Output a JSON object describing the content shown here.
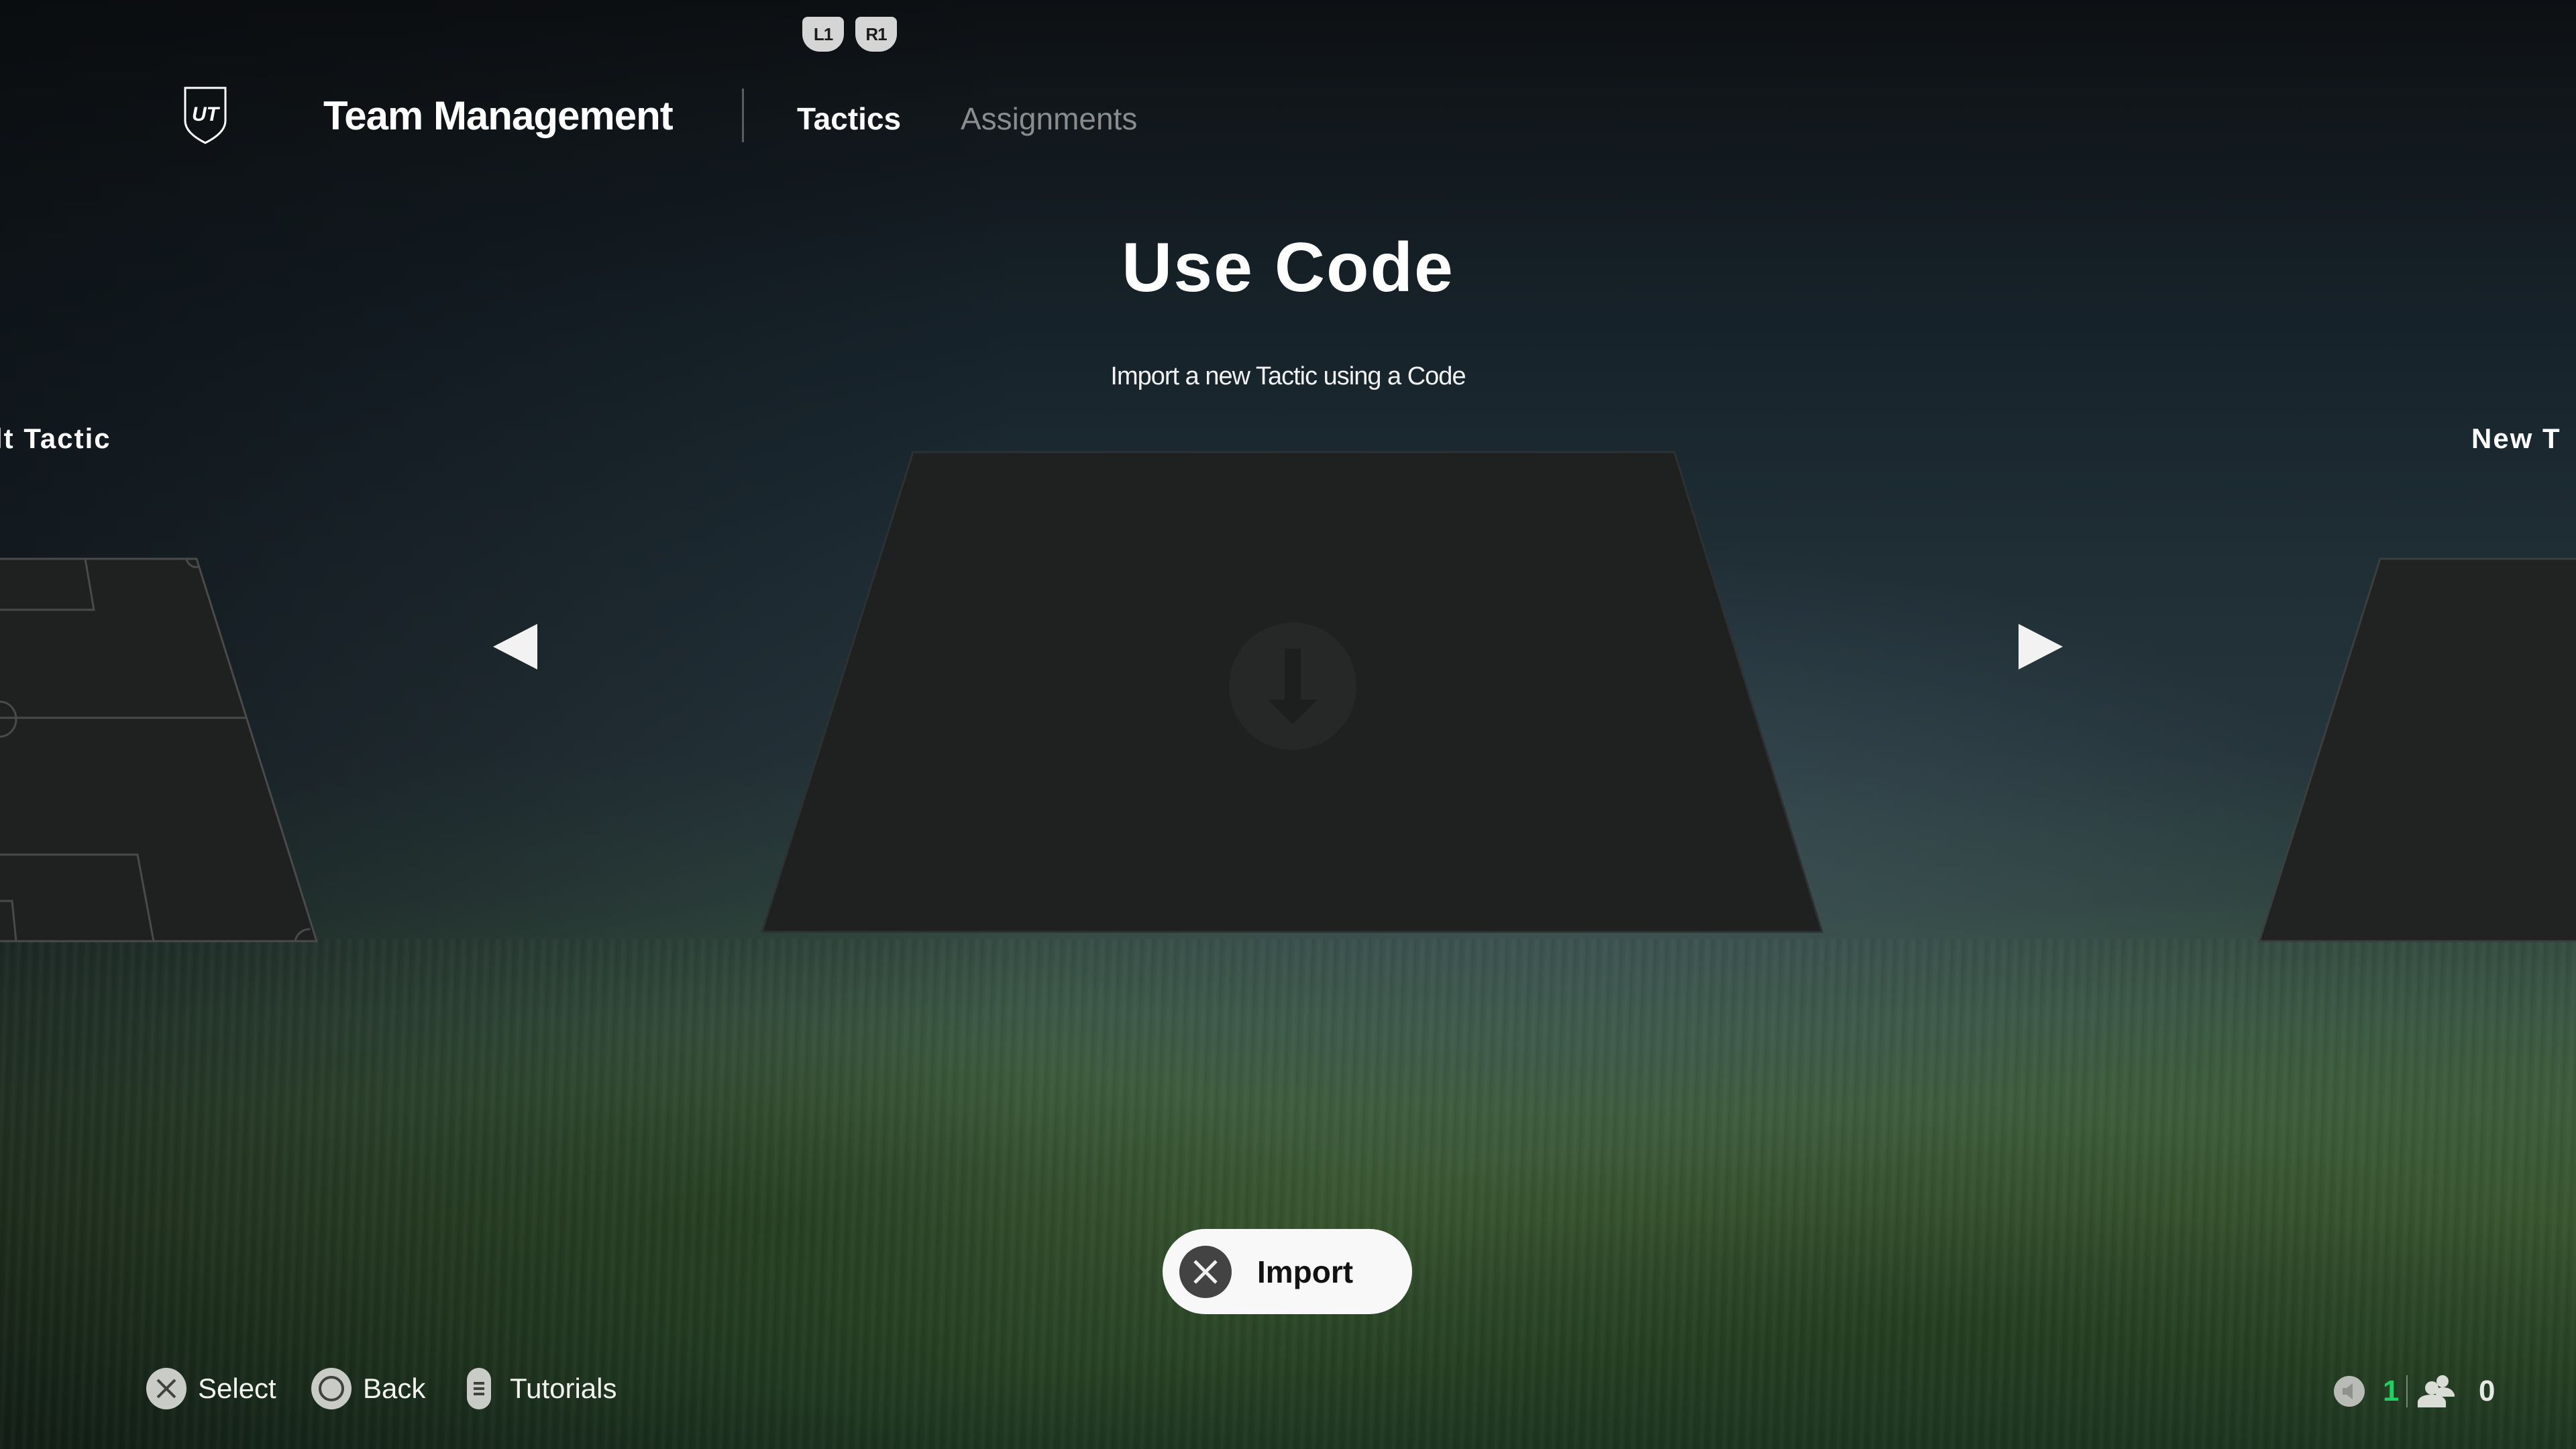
{
  "header": {
    "bumpers": {
      "left": "L1",
      "right": "R1"
    },
    "logo_text": "UT",
    "title": "Team Management",
    "tabs": [
      {
        "label": "Tactics",
        "active": true
      },
      {
        "label": "Assignments",
        "active": false
      }
    ]
  },
  "main": {
    "title": "Use Code",
    "subtitle": "Import a new Tactic using a Code",
    "carousel": {
      "previous_card_label": "lt Tactic",
      "current_card_icon": "download-icon",
      "next_card_label": "New T"
    },
    "import_button": {
      "icon": "cross-button-icon",
      "label": "Import"
    }
  },
  "footer": {
    "hints": [
      {
        "icon": "cross-button-icon",
        "label": "Select"
      },
      {
        "icon": "circle-button-icon",
        "label": "Back"
      },
      {
        "icon": "options-button-icon",
        "label": "Tutorials"
      }
    ],
    "status": {
      "voice_count": "1",
      "friends_count": "0",
      "voice_color": "#1fd160"
    }
  }
}
